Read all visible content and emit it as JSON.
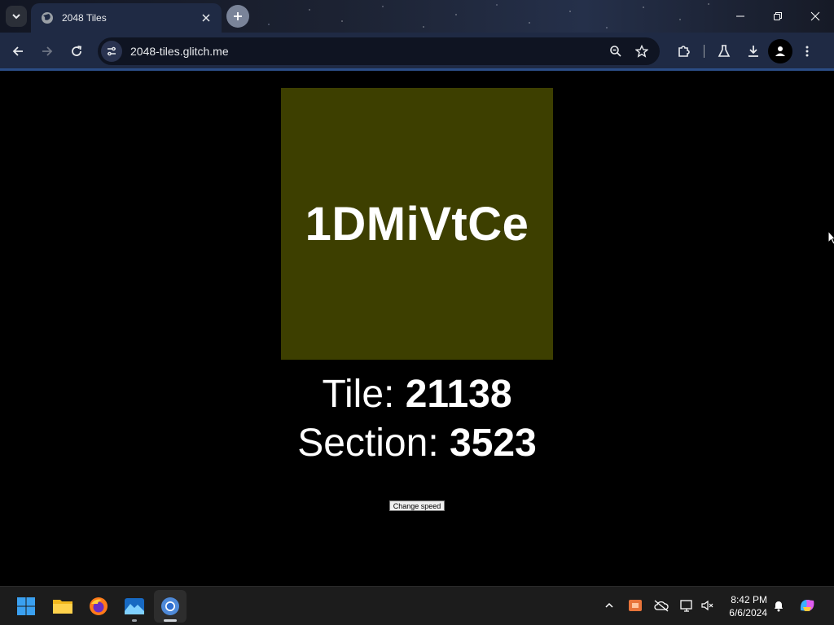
{
  "browser": {
    "tab": {
      "title": "2048 Tiles"
    },
    "url": "2048-tiles.glitch.me"
  },
  "game": {
    "tile_code": "1DMiVtCe",
    "tile_color": "#3d3f00",
    "tile_label": "Tile: ",
    "tile_number": "21138",
    "section_label": "Section: ",
    "section_number": "3523",
    "speed_button": "Change speed"
  },
  "taskbar": {
    "time": "8:42 PM",
    "date": "6/6/2024",
    "apps": [
      "start-icon",
      "file-explorer-icon",
      "firefox-icon",
      "photos-icon",
      "chrome-icon"
    ]
  }
}
